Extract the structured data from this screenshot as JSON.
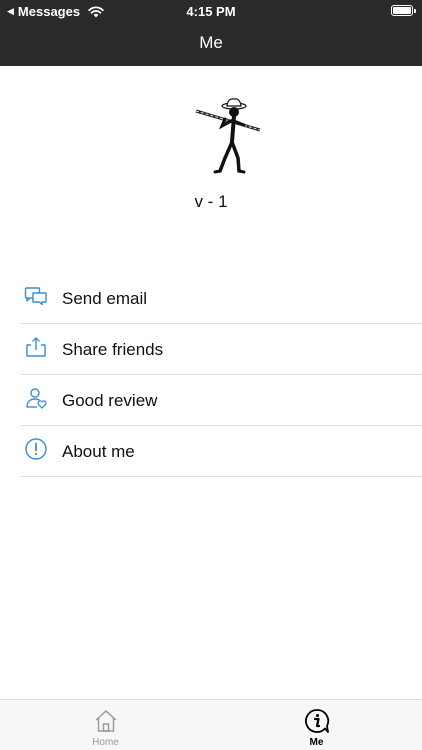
{
  "status_bar": {
    "back_app": "Messages",
    "time": "4:15 PM"
  },
  "header": {
    "title": "Me"
  },
  "profile": {
    "version": "v - 1"
  },
  "menu": {
    "items": [
      {
        "label": "Send email",
        "icon": "message-icon"
      },
      {
        "label": "Share friends",
        "icon": "share-icon"
      },
      {
        "label": "Good review",
        "icon": "user-heart-icon"
      },
      {
        "label": "About me",
        "icon": "info-icon"
      }
    ]
  },
  "tabbar": {
    "tabs": [
      {
        "label": "Home",
        "icon": "home-icon",
        "active": false
      },
      {
        "label": "Me",
        "icon": "info-chat-icon",
        "active": true
      }
    ]
  },
  "colors": {
    "header_bg": "#2b2b2b",
    "accent_icon": "#3a8fd1",
    "tab_active": "#000000",
    "tab_inactive": "#9a9a9a"
  }
}
